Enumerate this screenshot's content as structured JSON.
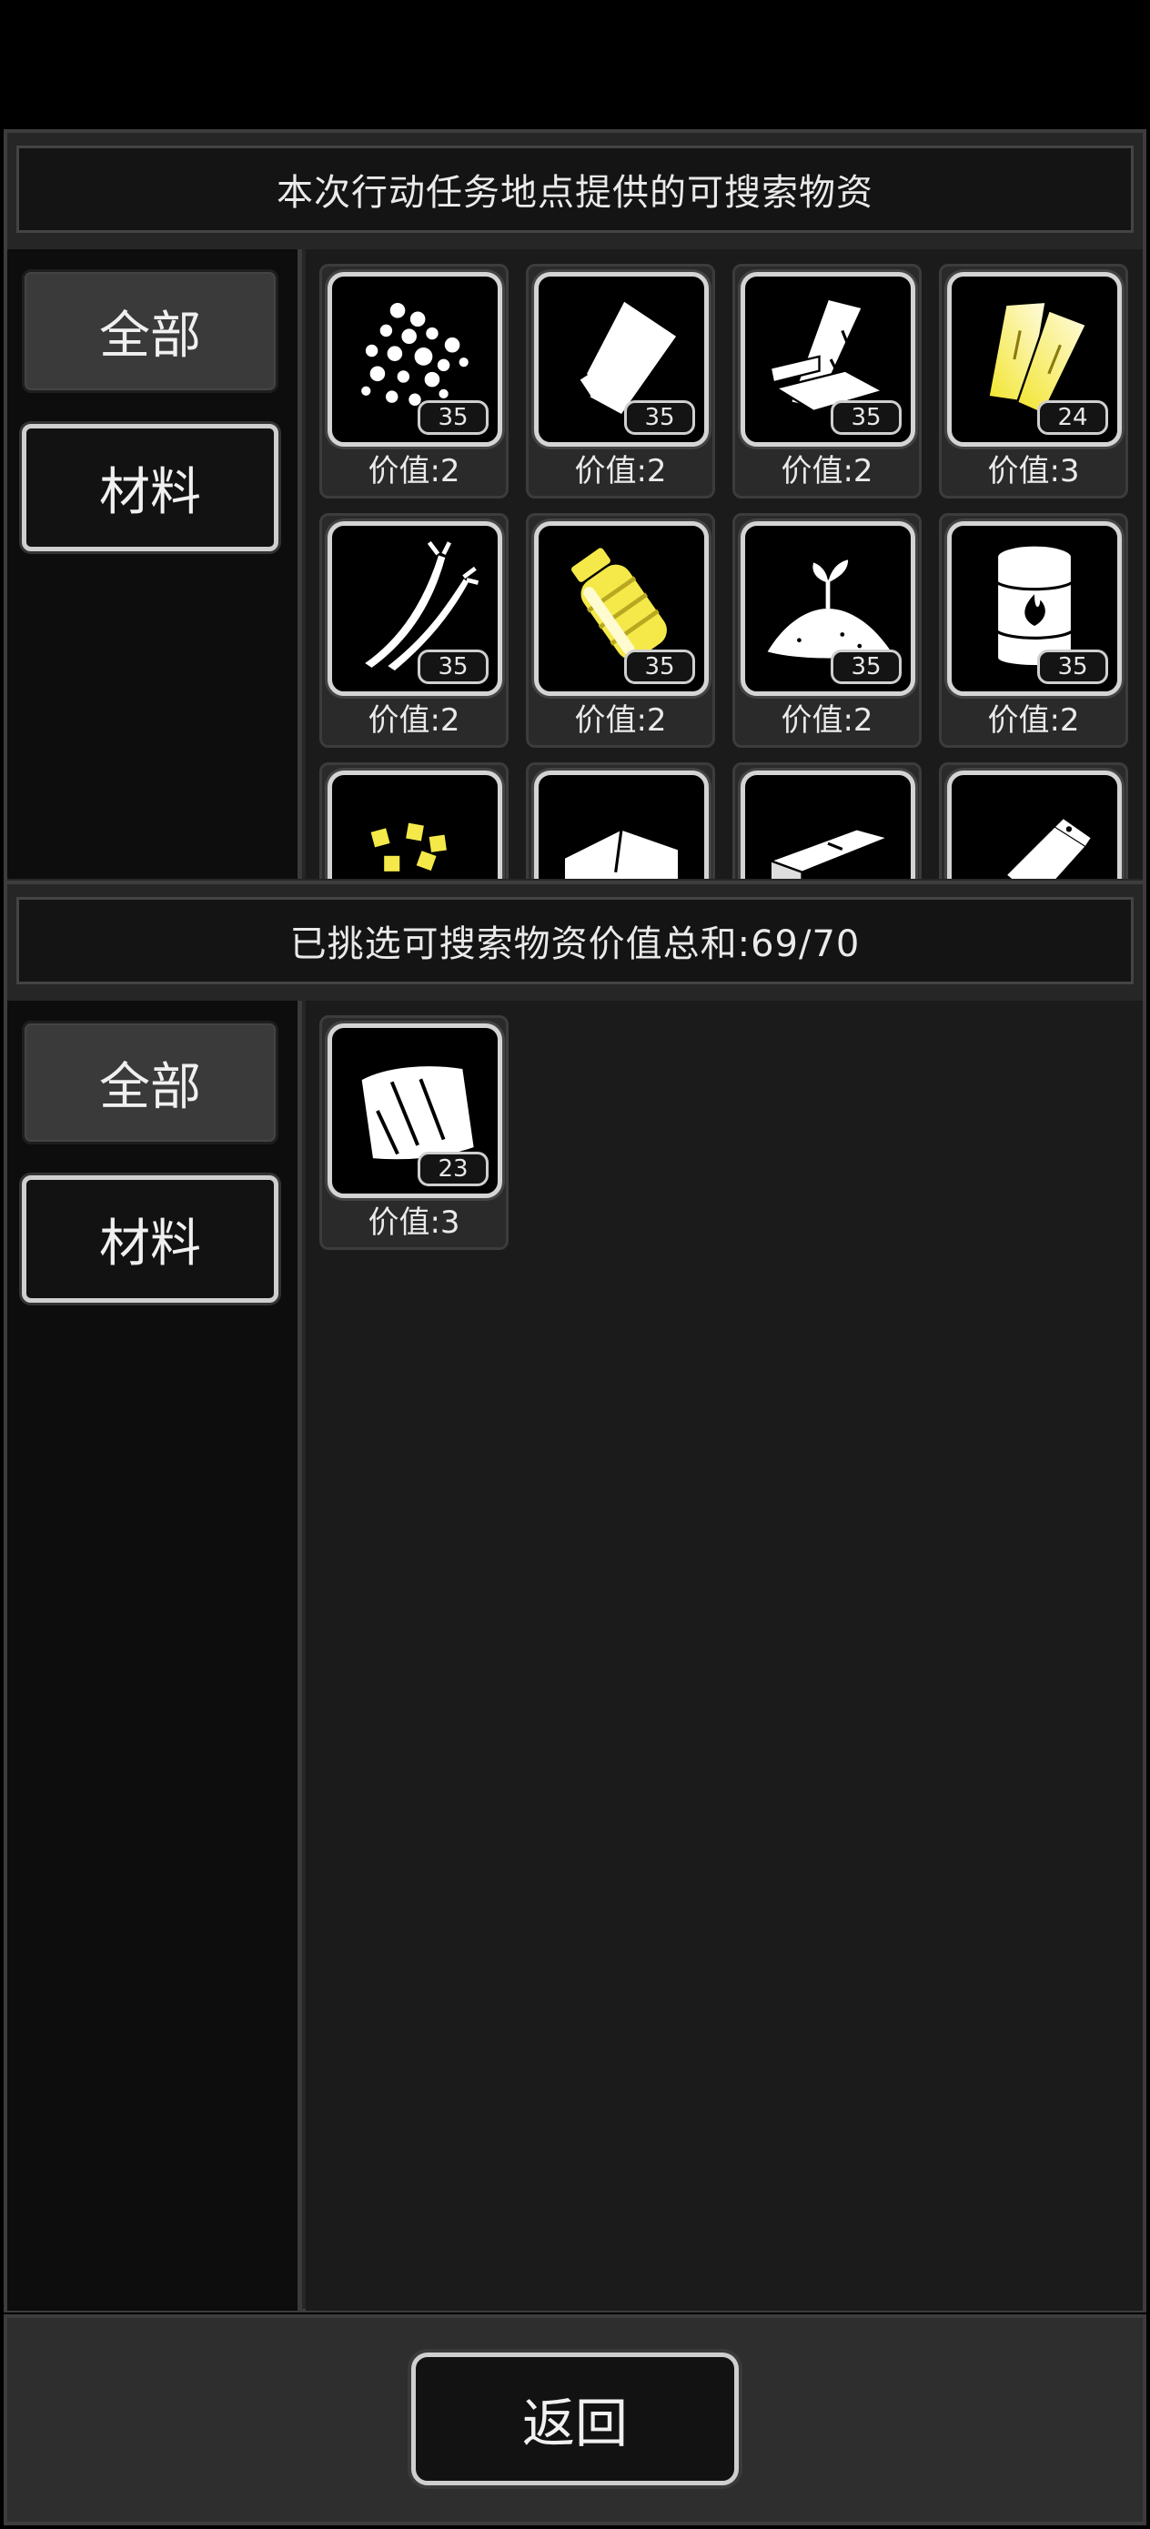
{
  "top_panel": {
    "title": "本次行动任务地点提供的可搜索物资",
    "tabs": [
      {
        "label": "全部"
      },
      {
        "label": "材料"
      }
    ],
    "items": [
      {
        "icon": "beads-icon",
        "count": "35",
        "value_label": "价值:2"
      },
      {
        "icon": "cloth-sheet-icon",
        "count": "35",
        "value_label": "价值:2"
      },
      {
        "icon": "wood-planks-icon",
        "count": "35",
        "value_label": "价值:2"
      },
      {
        "icon": "yellow-planks-icon",
        "count": "24",
        "value_label": "价值:3"
      },
      {
        "icon": "wires-icon",
        "count": "35",
        "value_label": "价值:2"
      },
      {
        "icon": "yellow-fuse-icon",
        "count": "35",
        "value_label": "价值:2"
      },
      {
        "icon": "soil-sprout-icon",
        "count": "35",
        "value_label": "价值:2"
      },
      {
        "icon": "fuel-barrel-icon",
        "count": "35",
        "value_label": "价值:2"
      },
      {
        "icon": "yellow-cubes-icon"
      },
      {
        "icon": "fabric-icon"
      },
      {
        "icon": "metal-bar-icon"
      },
      {
        "icon": "bag-icon"
      }
    ]
  },
  "bottom_panel": {
    "title": "已挑选可搜索物资价值总和:69/70",
    "tabs": [
      {
        "label": "全部"
      },
      {
        "label": "材料"
      }
    ],
    "items": [
      {
        "icon": "fabric-sheet-icon",
        "count": "23",
        "value_label": "价值:3"
      }
    ]
  },
  "footer": {
    "back_label": "返回"
  },
  "colors": {
    "tile_border": "#d4d4d4",
    "accent_yellow": "#f5e94a",
    "panel_bg": "#1b1b1b"
  }
}
